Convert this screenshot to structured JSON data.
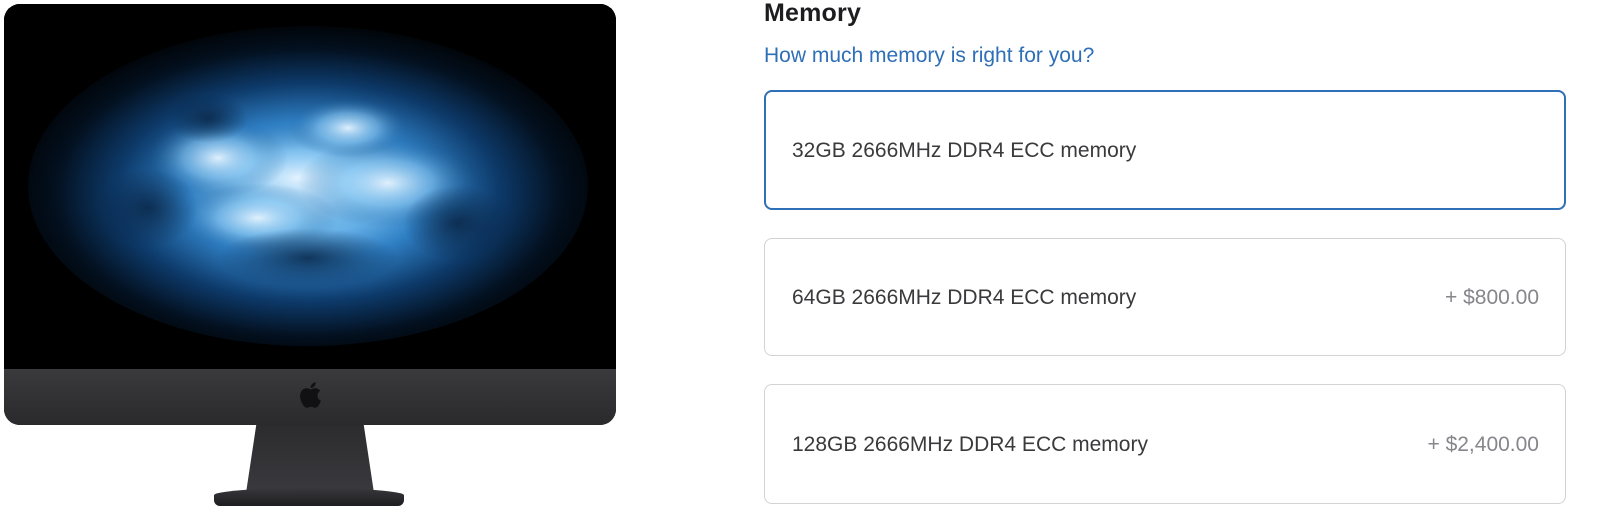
{
  "product": {
    "image_alt": "iMac Pro",
    "icon": "apple-logo-icon"
  },
  "memory": {
    "title": "Memory",
    "help_link": "How much memory is right for you?",
    "options": [
      {
        "label": "32GB 2666MHz DDR4 ECC memory",
        "price": "",
        "selected": true
      },
      {
        "label": "64GB 2666MHz DDR4 ECC memory",
        "price": "+ $800.00",
        "selected": false
      },
      {
        "label": "128GB 2666MHz DDR4 ECC memory",
        "price": "+ $2,400.00",
        "selected": false
      }
    ]
  },
  "colors": {
    "accent": "#2e6fb8",
    "option_border": "#d2d2d7",
    "price_text": "#86868b"
  }
}
